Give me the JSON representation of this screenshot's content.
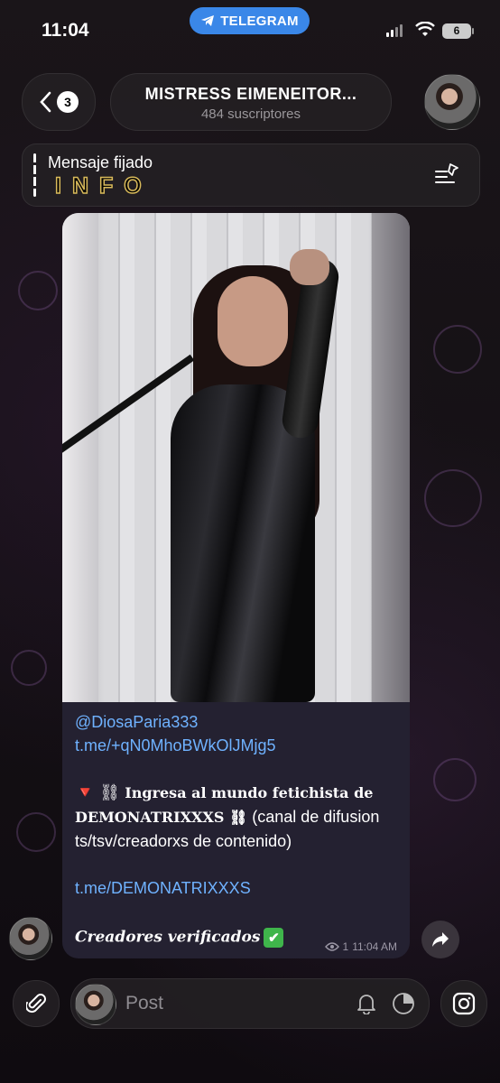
{
  "status_bar": {
    "time": "11:04",
    "telegram_label": "TELEGRAM",
    "battery": "6"
  },
  "header": {
    "back_count": "3",
    "channel_name": "MISTRESS EIMENEITOR...",
    "subscribers": "484 suscriptores"
  },
  "pinned": {
    "label": "Mensaje fijado",
    "text": "INFO"
  },
  "message": {
    "mention": "@DiosaParia333",
    "link1": "t.me/+qN0MhoBWkOlJMjg5",
    "line_prefix": "🔻 ⛓ ",
    "fancy_part1": "Ingresa al mundo fetichista de",
    "fancy_part2": "DEMONATRIXXXS ⛓",
    "rest": " (canal de difusion ts/tsv/creadorxs de contenido)",
    "link2": "t.me/DEMONATRIXXXS",
    "caption": "Creadores verificados",
    "check": "✔",
    "views": "1",
    "time": "11:04 AM"
  },
  "input_bar": {
    "placeholder": "Post"
  },
  "icons": {
    "back": "chevron-left-icon",
    "pin_list": "pinned-list-icon",
    "share": "share-icon",
    "attach": "paperclip-icon",
    "bell": "bell-icon",
    "schedule": "clock-icon",
    "instagram": "instagram-icon"
  },
  "colors": {
    "accent_blue": "#3a87e8",
    "link": "#6fb2ff",
    "bubble": "#242131"
  }
}
